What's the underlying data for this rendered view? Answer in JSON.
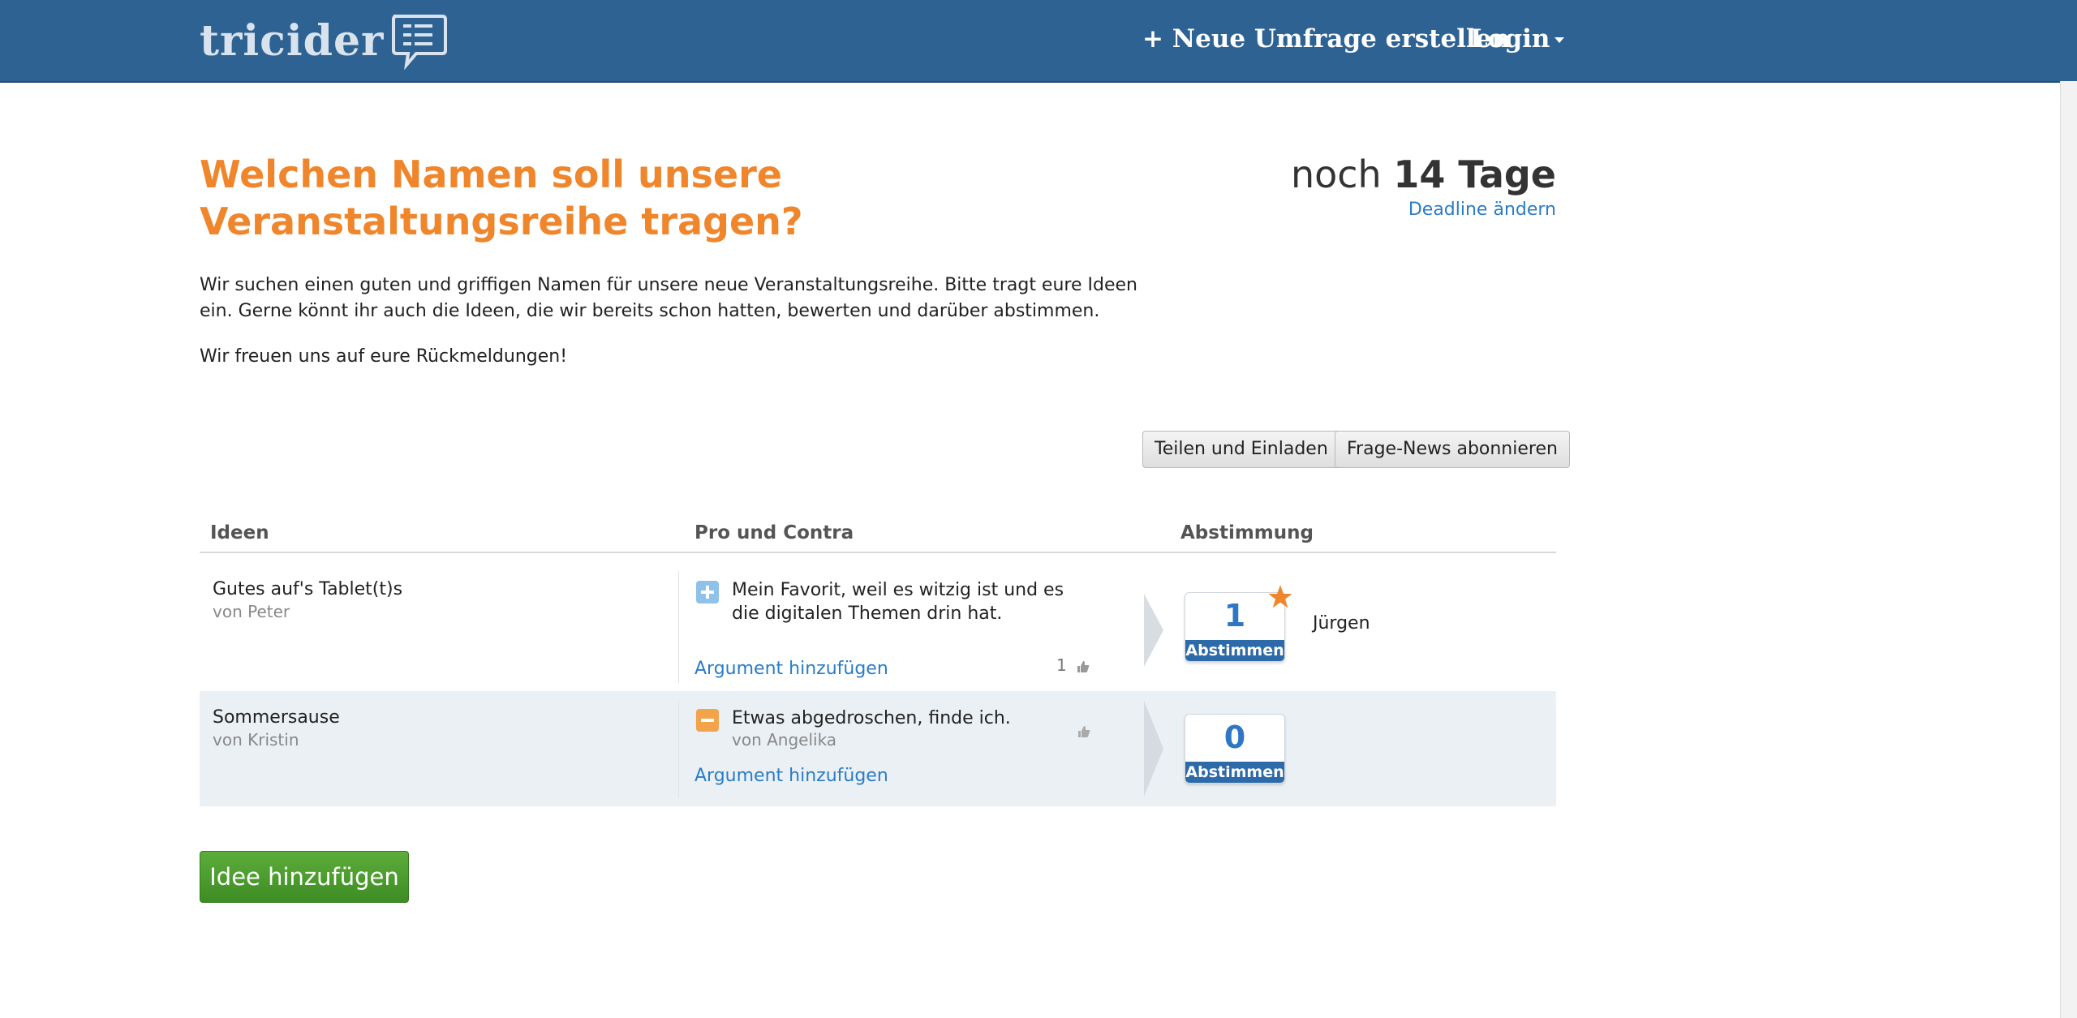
{
  "header": {
    "logo_text": "tricider",
    "create_label": "+ Neue Umfrage erstellen",
    "login_label": "Login"
  },
  "question": {
    "title": "Welchen Namen soll unsere Veranstaltungsreihe tragen?",
    "description_1": "Wir suchen einen guten und griffigen Namen für unsere neue Veranstaltungsreihe. Bitte tragt eure Ideen ein. Gerne könnt ihr auch die Ideen, die wir bereits schon hatten, bewerten und darüber abstimmen.",
    "description_2": "Wir freuen uns auf eure Rückmeldungen!"
  },
  "deadline": {
    "prefix": "noch",
    "days": "14 Tage",
    "change_label": "Deadline ändern"
  },
  "actions": {
    "share_label": "Teilen und Einladen",
    "subscribe_label": "Frage-News abonnieren",
    "add_idea_label": "Idee hinzufügen"
  },
  "table": {
    "headers": {
      "ideas": "Ideen",
      "pro_contra": "Pro und Contra",
      "vote": "Abstimmung"
    },
    "rows": [
      {
        "idea": "Gutes auf's Tablet(t)s",
        "author": "von Peter",
        "argument_type": "pro",
        "argument": "Mein Favorit, weil es witzig ist und es die digitalen Themen drin hat.",
        "argument_author": "",
        "likes": "1",
        "add_argument": "Argument hinzufügen",
        "votes": "1",
        "vote_label": "Abstimmen",
        "voters": "Jürgen",
        "favorite": true
      },
      {
        "idea": "Sommersause",
        "author": "von Kristin",
        "argument_type": "contra",
        "argument": "Etwas abgedroschen, finde ich.",
        "argument_author": "von Angelika",
        "likes": "",
        "add_argument": "Argument hinzufügen",
        "votes": "0",
        "vote_label": "Abstimmen",
        "voters": "",
        "favorite": false
      }
    ]
  },
  "colors": {
    "header_bg": "#2e6293",
    "title": "#f0862c",
    "link": "#2a7cc7",
    "vote_button": "#2d6aa9",
    "add_button": "#4a9a2e",
    "pro_icon": "#8ec2ea",
    "contra_icon": "#f3a34a",
    "star": "#f0862c"
  },
  "icons": {
    "logo_bubble": "speech-bubble-icon",
    "login_caret": "caret-down-icon",
    "pro": "plus-icon",
    "contra": "minus-icon",
    "like": "thumbs-up-icon",
    "favorite": "star-icon",
    "row_arrow": "chevron-right-icon"
  }
}
